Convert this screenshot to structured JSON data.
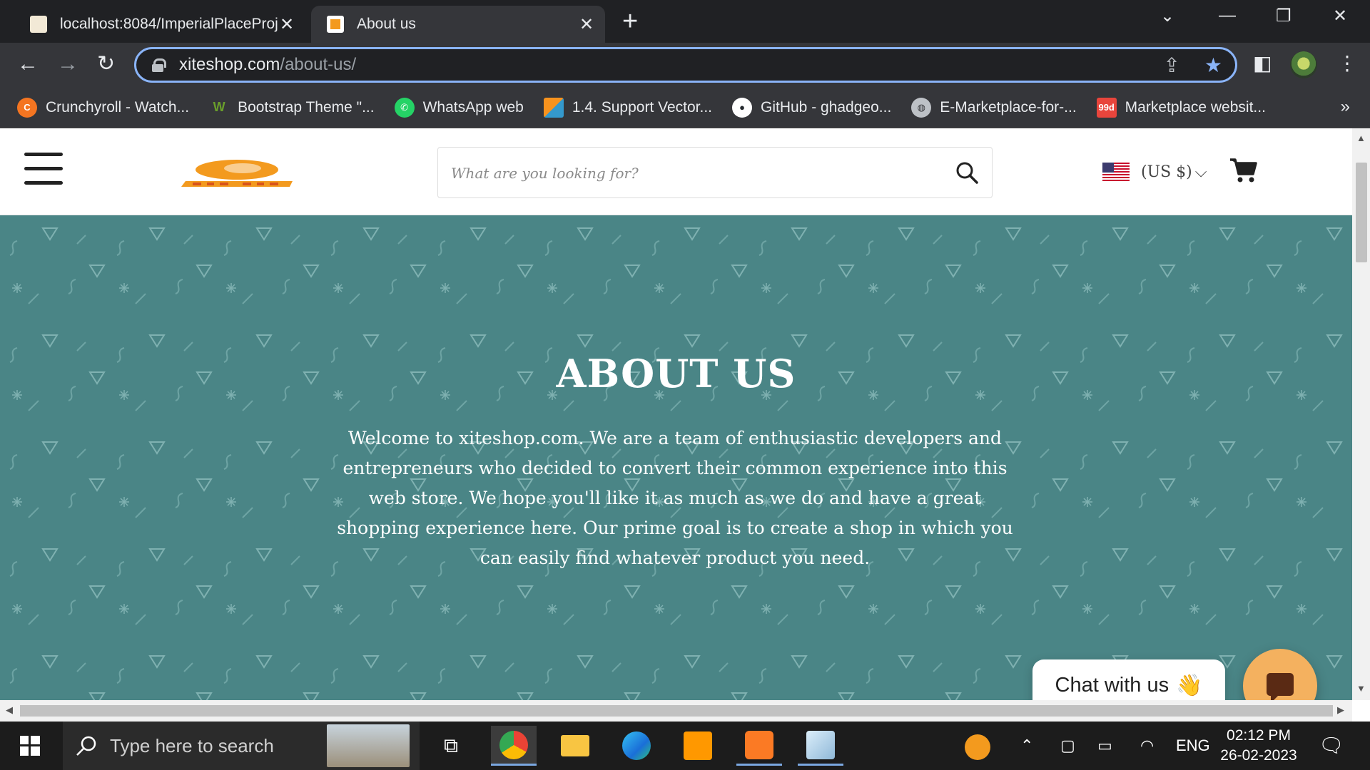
{
  "browser": {
    "tabs": [
      {
        "title": "localhost:8084/ImperialPlaceProj",
        "active": false
      },
      {
        "title": "About us",
        "active": true
      }
    ],
    "new_tab": "+",
    "address": {
      "domain": "xiteshop.com",
      "path": "/about-us/"
    },
    "bookmarks": [
      {
        "label": "Crunchyroll - Watch...",
        "icon": "crunchyroll-icon",
        "color": "#f47521"
      },
      {
        "label": "Bootstrap Theme \"...",
        "icon": "bootstrap-icon",
        "color": "#6a9f2b"
      },
      {
        "label": "WhatsApp web",
        "icon": "whatsapp-icon",
        "color": "#25d366"
      },
      {
        "label": "1.4. Support Vector...",
        "icon": "scikit-icon",
        "color": "#f7931e"
      },
      {
        "label": "GitHub - ghadgeo...",
        "icon": "github-icon",
        "color": "#ffffff"
      },
      {
        "label": "E-Marketplace-for-...",
        "icon": "globe-icon",
        "color": "#bdc1c6"
      },
      {
        "label": "Marketplace websit...",
        "icon": "99designs-icon",
        "color": "#e8453c"
      }
    ],
    "bookmarks_more": "»"
  },
  "site": {
    "search_placeholder": "What are you looking for?",
    "currency": "(US $)",
    "hero": {
      "title": "ABOUT US",
      "text": "Welcome to xiteshop.com. We are a team of enthusiastic developers and entrepreneurs who decided to convert their common experience into this web store. We hope you'll like it as much as we do and have a great shopping experience here. Our prime goal is to create a shop in which you can easily find whatever product you need."
    },
    "chat": {
      "label": "Chat with us",
      "emoji": "👋"
    },
    "colors": {
      "hero_bg": "#4a8586",
      "chat_button": "#f4b15f"
    }
  },
  "taskbar": {
    "search_placeholder": "Type here to search",
    "language": "ENG",
    "time": "02:12 PM",
    "date": "26-02-2023"
  }
}
